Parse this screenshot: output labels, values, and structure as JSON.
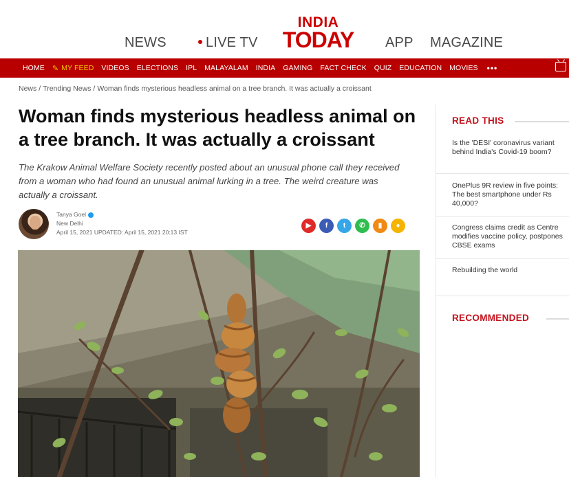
{
  "header": {
    "links": {
      "news": "NEWS",
      "live_tv": "LIVE TV",
      "app": "APP",
      "magazine": "MAGAZINE"
    },
    "logo": {
      "line1": "INDIA",
      "line2": "TODAY",
      "color": "#cc0000"
    }
  },
  "nav": {
    "items": [
      "HOME",
      "MY FEED",
      "VIDEOS",
      "ELECTIONS",
      "IPL",
      "MALAYALAM",
      "INDIA",
      "GAMING",
      "FACT CHECK",
      "QUIZ",
      "EDUCATION",
      "MOVIES"
    ],
    "more": "•••",
    "background": "#b80000",
    "highlight_color": "#f7c300",
    "right_icon": "tv-icon"
  },
  "breadcrumb": {
    "items": [
      "News",
      "Trending News",
      "Woman finds mysterious headless animal on a tree branch. It was actually a croissant"
    ]
  },
  "article": {
    "headline": "Woman finds mysterious headless animal on a tree branch. It was actually a croissant",
    "summary": "The Krakow Animal Welfare Society recently posted about an unusual phone call they received from a woman who had found an unusual animal lurking in a tree. The weird creature was actually a croissant.",
    "author": "Tanya Goel",
    "location": "New Delhi",
    "dates": "April 15, 2021 UPDATED: April 15, 2021 20:13 IST",
    "share_icons": [
      "youtube-icon",
      "facebook-icon",
      "twitter-icon",
      "whatsapp-icon",
      "bookmark-icon",
      "comment-icon"
    ]
  },
  "sidebar": {
    "read_this_title": "READ THIS",
    "read_this_items": [
      "Is the 'DESI' coronavirus variant behind India's Covid-19 boom?",
      "OnePlus 9R review in five points: The best smartphone under Rs 40,000?",
      "Congress claims credit as Centre modifies vaccine policy, postpones CBSE exams",
      "Rebuilding the world"
    ],
    "recommended_title": "RECOMMENDED",
    "accent": "#c3121c"
  }
}
